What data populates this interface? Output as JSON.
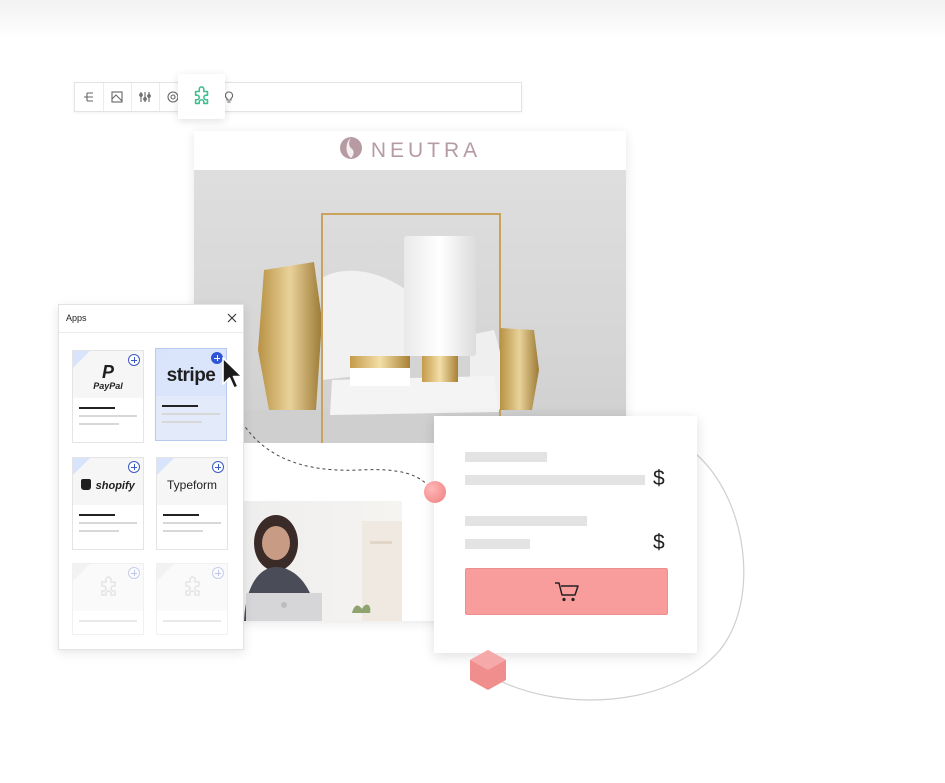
{
  "email": {
    "brand_name": "NEUTRA"
  },
  "apps_panel": {
    "title": "Apps",
    "tiles": [
      {
        "name": "PayPal",
        "state": "available"
      },
      {
        "name": "stripe",
        "state": "selected"
      },
      {
        "name": "shopify",
        "state": "available"
      },
      {
        "name": "Typeform",
        "state": "available"
      },
      {
        "name": "",
        "state": "placeholder"
      },
      {
        "name": "",
        "state": "placeholder"
      }
    ]
  },
  "checkout": {
    "currency_1": "$",
    "currency_2": "$"
  },
  "toolbar": {
    "icons": [
      "hierarchy-icon",
      "layout-icon",
      "sliders-icon",
      "target-icon",
      "puzzle-icon",
      "lightbulb-icon"
    ],
    "active_icon": "puzzle-icon"
  },
  "colors": {
    "accent_green": "#3fbf8f",
    "cart_button": "#f99c9c",
    "brand": "#b79ba2",
    "selection_blue": "#2f55d4"
  }
}
